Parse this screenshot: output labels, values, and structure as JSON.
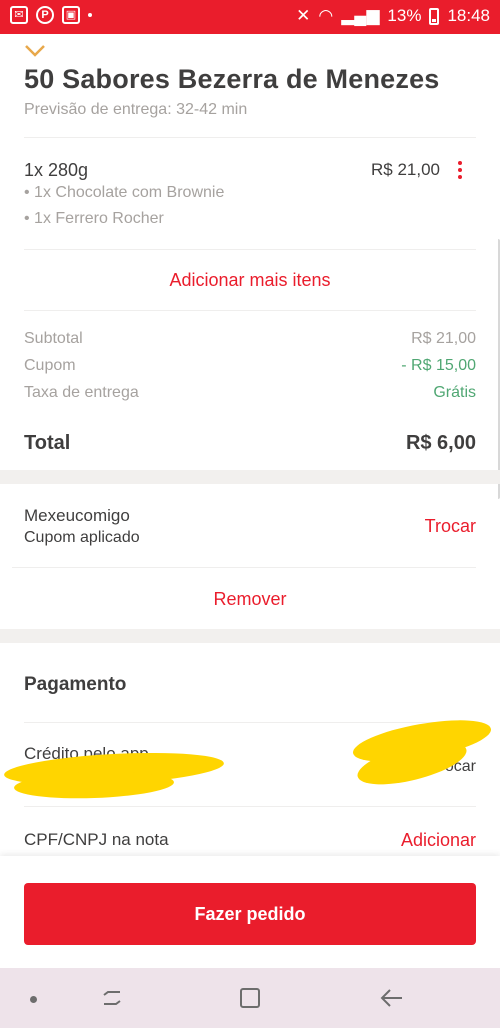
{
  "status_bar": {
    "time": "18:48",
    "battery": "13%"
  },
  "store": {
    "name": "50 Sabores Bezerra de Menezes",
    "delivery_estimate": "Previsão de entrega: 32-42 min"
  },
  "cart": {
    "item": {
      "title": "1x 280g",
      "price": "R$ 21,00",
      "addons": [
        "• 1x Chocolate com Brownie",
        "• 1x Ferrero Rocher"
      ]
    },
    "add_more_label": "Adicionar mais itens"
  },
  "summary": {
    "subtotal_label": "Subtotal",
    "subtotal_value": "R$ 21,00",
    "coupon_label": "Cupom",
    "coupon_value": "- R$ 15,00",
    "delivery_label": "Taxa de entrega",
    "delivery_value": "Grátis",
    "total_label": "Total",
    "total_value": "R$ 6,00"
  },
  "coupon": {
    "code": "Mexeucomigo",
    "status": "Cupom aplicado",
    "swap_label": "Trocar",
    "remove_label": "Remover"
  },
  "payment": {
    "title": "Pagamento",
    "method": "Crédito pelo app",
    "change_label": "Trocar"
  },
  "invoice": {
    "label": "CPF/CNPJ na nota",
    "add_label": "Adicionar"
  },
  "footer": {
    "order_button": "Fazer pedido"
  },
  "colors": {
    "brand_red": "#ea1d2c",
    "discount_green": "#50a773",
    "muted_text": "#a6a29f",
    "redaction_yellow": "#ffd500"
  },
  "icons": [
    "mail-icon",
    "parking-icon",
    "image-icon",
    "mute-icon",
    "wifi-icon",
    "signal-icon",
    "battery-icon",
    "chevron-down-icon",
    "more-vertical-icon",
    "recent-apps-icon",
    "home-icon",
    "back-icon"
  ]
}
